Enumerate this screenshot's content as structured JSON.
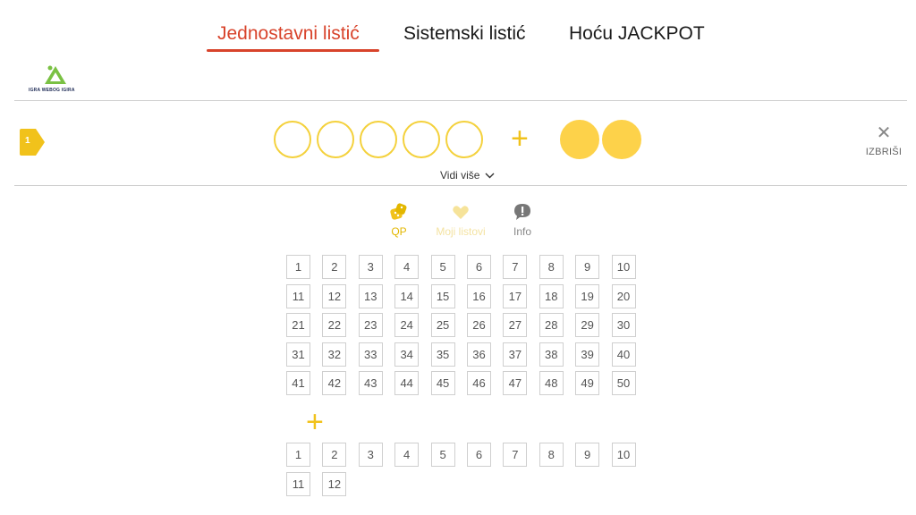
{
  "tabs": [
    {
      "label": "Jednostavni listić",
      "active": true
    },
    {
      "label": "Sistemski listić",
      "active": false
    },
    {
      "label": "Hoću JACKPOT",
      "active": false
    }
  ],
  "logo": {
    "text": "IGRA WEBOG IGIRA"
  },
  "ticket": {
    "badge": "1",
    "main_slots": 5,
    "extra_slots": 2,
    "see_more": "Vidi više",
    "clear_label": "IZBRIŠI"
  },
  "actions": {
    "qp": "QP",
    "favorites": "Moji listovi",
    "info": "Info"
  },
  "main_numbers": [
    1,
    2,
    3,
    4,
    5,
    6,
    7,
    8,
    9,
    10,
    11,
    12,
    13,
    14,
    15,
    16,
    17,
    18,
    19,
    20,
    21,
    22,
    23,
    24,
    25,
    26,
    27,
    28,
    29,
    30,
    31,
    32,
    33,
    34,
    35,
    36,
    37,
    38,
    39,
    40,
    41,
    42,
    43,
    44,
    45,
    46,
    47,
    48,
    49,
    50
  ],
  "extra_numbers": [
    1,
    2,
    3,
    4,
    5,
    6,
    7,
    8,
    9,
    10,
    11,
    12
  ],
  "colors": {
    "accent": "#d8432b",
    "yellow": "#fdd24a",
    "yellow_dark": "#e3b700"
  }
}
